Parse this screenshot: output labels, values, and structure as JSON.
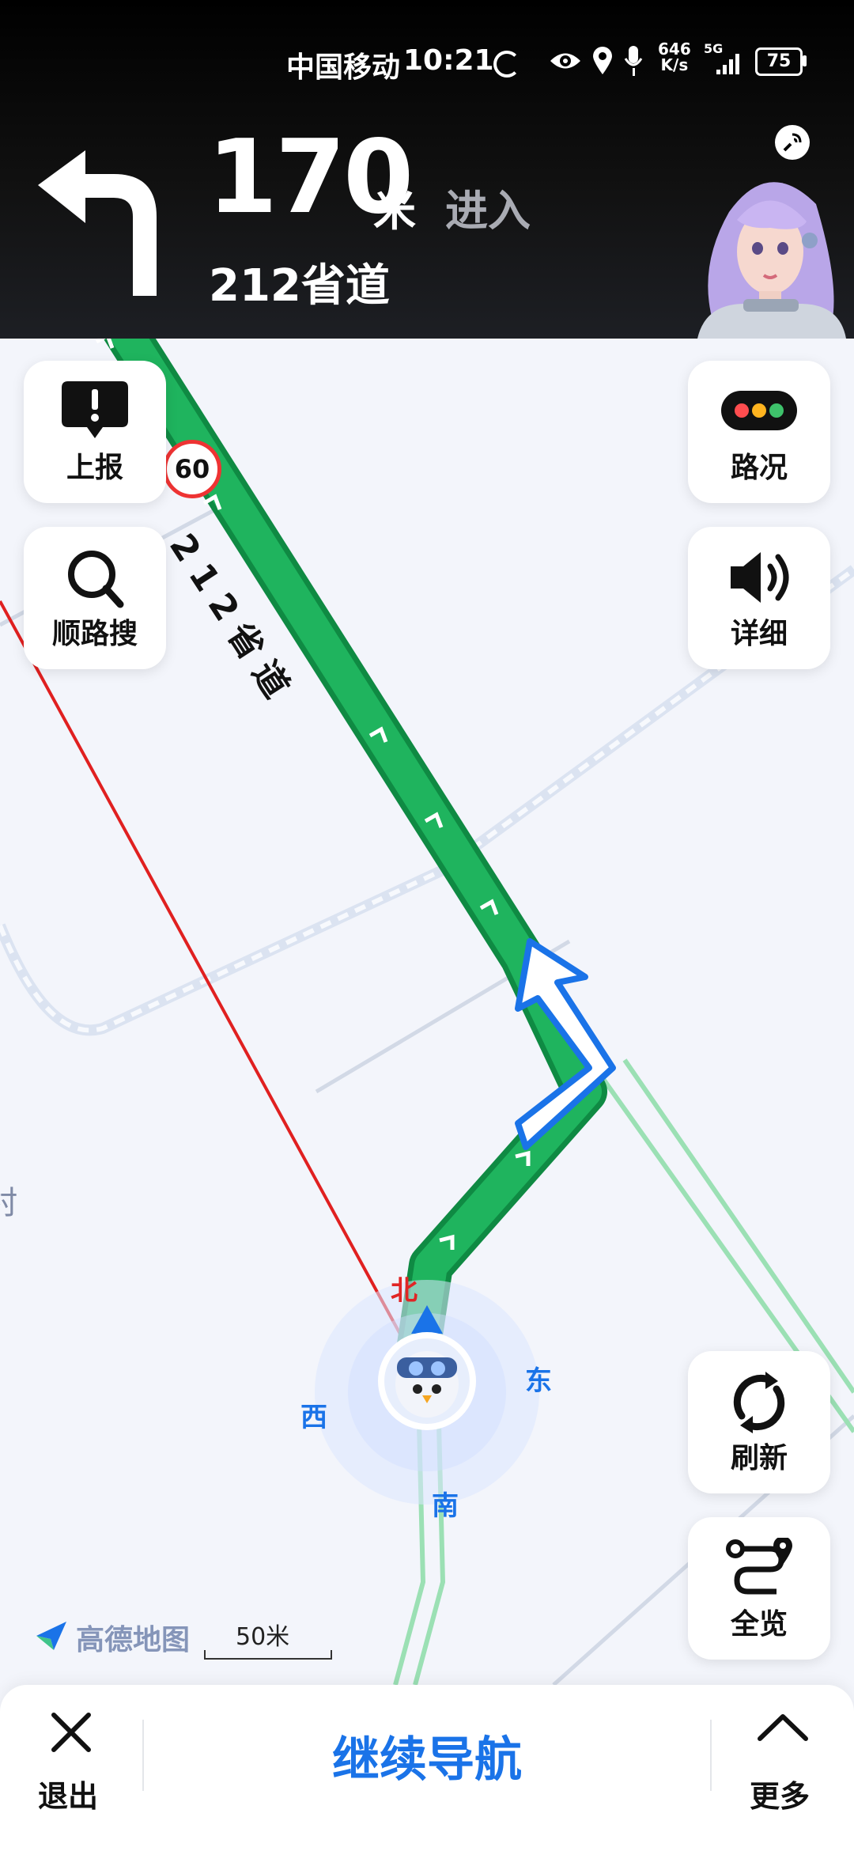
{
  "status_bar": {
    "carrier": "中国移动",
    "time": "10:21",
    "net_speed_value": "646",
    "net_speed_unit": "K/s",
    "network": "5G",
    "battery": "75"
  },
  "guidance": {
    "distance": "170",
    "unit": "米",
    "action": "进入",
    "road": "212省道",
    "turn_icon": "turn-left-arrow-icon"
  },
  "left_controls": [
    {
      "label": "上报",
      "icon": "report-icon"
    },
    {
      "label": "顺路搜",
      "icon": "search-icon"
    }
  ],
  "right_controls": [
    {
      "label": "路况",
      "icon": "traffic-light-icon"
    },
    {
      "label": "详细",
      "icon": "speaker-icon"
    },
    {
      "label": "刷新",
      "icon": "refresh-icon"
    },
    {
      "label": "全览",
      "icon": "route-overview-icon"
    }
  ],
  "map": {
    "road_label": "212省道",
    "speed_limit_1": "60",
    "speed_limit_2": "60",
    "partial_place": "村",
    "compass": {
      "north": "北",
      "south": "南",
      "east": "东",
      "west": "西"
    },
    "logo_text": "高德地图",
    "scale": "50米",
    "route_color": "#1aaa55",
    "maneuver_color": "#1a73e8",
    "boundary_color": "#e02020"
  },
  "bottom_bar": {
    "exit": "退出",
    "continue": "继续导航",
    "more": "更多"
  }
}
